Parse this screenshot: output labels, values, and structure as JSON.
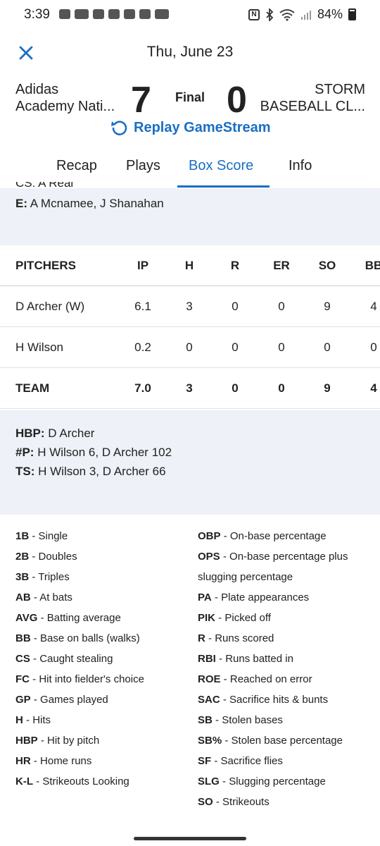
{
  "status_bar": {
    "time": "3:39",
    "battery": "84%",
    "icons": [
      "message-icon",
      "ring-icon",
      "teams-icon",
      "gc-icon",
      "gc-icon",
      "puppet-icon",
      "imdb-icon"
    ]
  },
  "header": {
    "date": "Thu, June 23",
    "home_team_line1": "Adidas",
    "home_team_line2": "Academy Nati...",
    "home_score": "7",
    "status": "Final",
    "away_score": "0",
    "away_team_line1": "STORM",
    "away_team_line2": "BASEBALL CL...",
    "replay_label": "Replay GameStream"
  },
  "tabs": [
    "Recap",
    "Plays",
    "Box Score",
    "Info"
  ],
  "active_tab": "Box Score",
  "info_top": {
    "cut_text": "CS: A Real",
    "e_label": "E:",
    "e_value": "A Mcnamee, J Shanahan"
  },
  "pitchers": {
    "columns": [
      "PITCHERS",
      "IP",
      "H",
      "R",
      "ER",
      "SO",
      "BB"
    ],
    "rows": [
      {
        "name": "D Archer (W)",
        "ip": "6.1",
        "h": "3",
        "r": "0",
        "er": "0",
        "so": "9",
        "bb": "4"
      },
      {
        "name": "H Wilson",
        "ip": "0.2",
        "h": "0",
        "r": "0",
        "er": "0",
        "so": "0",
        "bb": "0"
      }
    ],
    "team": {
      "name": "TEAM",
      "ip": "7.0",
      "h": "3",
      "r": "0",
      "er": "0",
      "so": "9",
      "bb": "4"
    }
  },
  "pitch_info": [
    {
      "label": "HBP:",
      "value": "D Archer"
    },
    {
      "label": "#P:",
      "value": "H Wilson 6, D Archer 102"
    },
    {
      "label": "TS:",
      "value": "H Wilson 3, D Archer 66"
    }
  ],
  "glossary_left": [
    {
      "abbr": "1B",
      "desc": "Single"
    },
    {
      "abbr": "2B",
      "desc": "Doubles"
    },
    {
      "abbr": "3B",
      "desc": "Triples"
    },
    {
      "abbr": "AB",
      "desc": "At bats"
    },
    {
      "abbr": "AVG",
      "desc": "Batting average"
    },
    {
      "abbr": "BB",
      "desc": "Base on balls (walks)"
    },
    {
      "abbr": "CS",
      "desc": "Caught stealing"
    },
    {
      "abbr": "FC",
      "desc": "Hit into fielder's choice"
    },
    {
      "abbr": "GP",
      "desc": "Games played"
    },
    {
      "abbr": "H",
      "desc": "Hits"
    },
    {
      "abbr": "HBP",
      "desc": "Hit by pitch"
    },
    {
      "abbr": "HR",
      "desc": "Home runs"
    },
    {
      "abbr": "K-L",
      "desc": "Strikeouts Looking"
    }
  ],
  "glossary_right": [
    {
      "abbr": "OBP",
      "desc": "On-base percentage"
    },
    {
      "abbr": "OPS",
      "desc": "On-base percentage plus"
    },
    {
      "abbr": "",
      "desc": "slugging percentage"
    },
    {
      "abbr": "PA",
      "desc": "Plate appearances"
    },
    {
      "abbr": "PIK",
      "desc": "Picked off"
    },
    {
      "abbr": "R",
      "desc": "Runs scored"
    },
    {
      "abbr": "RBI",
      "desc": "Runs batted in"
    },
    {
      "abbr": "ROE",
      "desc": "Reached on error"
    },
    {
      "abbr": "SAC",
      "desc": "Sacrifice hits & bunts"
    },
    {
      "abbr": "SB",
      "desc": "Stolen bases"
    },
    {
      "abbr": "SB%",
      "desc": "Stolen base percentage"
    },
    {
      "abbr": "SF",
      "desc": "Sacrifice flies"
    },
    {
      "abbr": "SLG",
      "desc": "Slugging percentage"
    },
    {
      "abbr": "SO",
      "desc": "Strikeouts"
    }
  ],
  "colors": {
    "accent": "#1a6fc4",
    "section_bg": "#eef1f7"
  }
}
